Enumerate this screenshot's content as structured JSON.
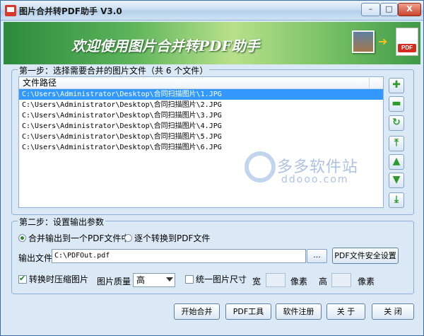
{
  "window": {
    "title": "图片合并转PDF助手 V3.0"
  },
  "titlebar_buttons": {
    "minimize": "–",
    "maximize": "□",
    "close": "X"
  },
  "banner": {
    "text": "欢迎使用图片合并转PDF助手",
    "arrow": "➜",
    "pdf_badge": "PDF"
  },
  "step1": {
    "title": "第一步：选择需要合并的图片文件（共 6 个文件）",
    "column_header": "文件路径",
    "files": [
      "C:\\Users\\Administrator\\Desktop\\合同扫描图片\\1.JPG",
      "C:\\Users\\Administrator\\Desktop\\合同扫描图片\\2.JPG",
      "C:\\Users\\Administrator\\Desktop\\合同扫描图片\\3.JPG",
      "C:\\Users\\Administrator\\Desktop\\合同扫描图片\\4.JPG",
      "C:\\Users\\Administrator\\Desktop\\合同扫描图片\\5.JPG",
      "C:\\Users\\Administrator\\Desktop\\合同扫描图片\\6.JPG"
    ],
    "selected_index": 0
  },
  "tools": {
    "add": "✚",
    "remove": "▬",
    "clear": "↻",
    "top": "⤒",
    "up": "▲",
    "down": "▼",
    "bottom": "⤓"
  },
  "watermark": {
    "cn": "多多软件站",
    "en": "ddooo.com"
  },
  "step2": {
    "title": "第二步：设置输出参数",
    "radio_merge": "合并输出到一个PDF文件中",
    "radio_each": "逐个转换到PDF文件",
    "output_label": "输出文件",
    "output_value": "C:\\PDFOut.pdf",
    "browse": "...",
    "security_button": "PDF文件安全设置",
    "compress_label": "转换时压缩图片",
    "compress_checked": true,
    "quality_label": "图片质量",
    "quality_value": "高",
    "unify_label": "统一图片尺寸",
    "unify_checked": false,
    "width_label": "宽",
    "width_unit": "像素",
    "height_label": "高",
    "height_unit": "像素"
  },
  "bottom_buttons": {
    "start": "开始合并",
    "pdf_tool": "PDF工具",
    "register": "软件注册",
    "about": "关 于",
    "close": "关 闭"
  },
  "colors": {
    "selection": "#3399ff",
    "window_bg": "#dbe8f5",
    "accent_green": "#2e9a2e"
  }
}
